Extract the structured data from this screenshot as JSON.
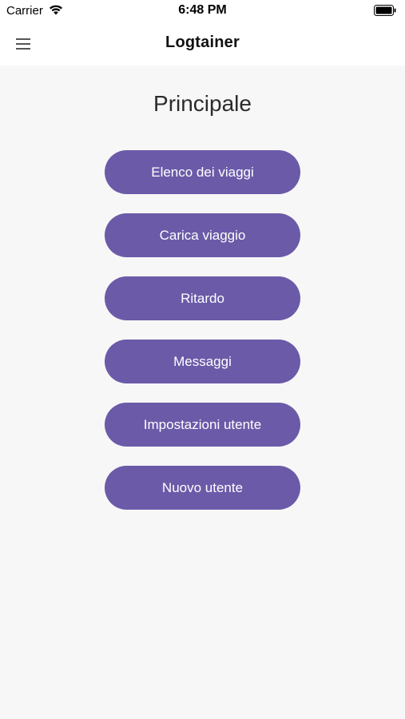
{
  "status_bar": {
    "carrier": "Carrier",
    "time": "6:48 PM",
    "icons": [
      "wifi-icon",
      "battery-icon"
    ]
  },
  "nav_bar": {
    "title": "Logtainer",
    "menu_icon": "hamburger-menu-icon"
  },
  "main": {
    "title": "Principale",
    "buttons": [
      {
        "label": "Elenco dei viaggi"
      },
      {
        "label": "Carica viaggio"
      },
      {
        "label": "Ritardo"
      },
      {
        "label": "Messaggi"
      },
      {
        "label": "Impostazioni utente"
      },
      {
        "label": "Nuovo utente"
      }
    ]
  },
  "colors": {
    "accent": "#6b5aa8",
    "background": "#f7f7f7",
    "bar_background": "#ffffff"
  }
}
